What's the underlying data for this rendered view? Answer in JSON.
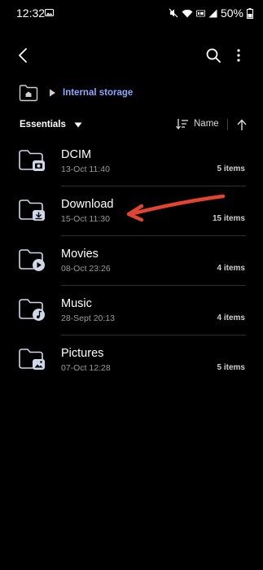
{
  "status_bar": {
    "time": "12:32",
    "battery": "50%"
  },
  "breadcrumb": {
    "current": "Internal storage"
  },
  "sort": {
    "filter_label": "Essentials",
    "sort_by": "Name"
  },
  "folders": [
    {
      "name": "DCIM",
      "date": "13-Oct 11:40",
      "count": "5 items",
      "badge": "camera-icon"
    },
    {
      "name": "Download",
      "date": "15-Oct 11:30",
      "count": "15 items",
      "badge": "download-icon"
    },
    {
      "name": "Movies",
      "date": "08-Oct 23:26",
      "count": "4 items",
      "badge": "play-icon"
    },
    {
      "name": "Music",
      "date": "28-Sept 20:13",
      "count": "4 items",
      "badge": "music-note-icon"
    },
    {
      "name": "Pictures",
      "date": "07-Oct 12:28",
      "count": "5 items",
      "badge": "image-icon"
    }
  ],
  "colors": {
    "accent": "#8aa8ff",
    "annotation": "#e04433",
    "background": "#000000"
  }
}
